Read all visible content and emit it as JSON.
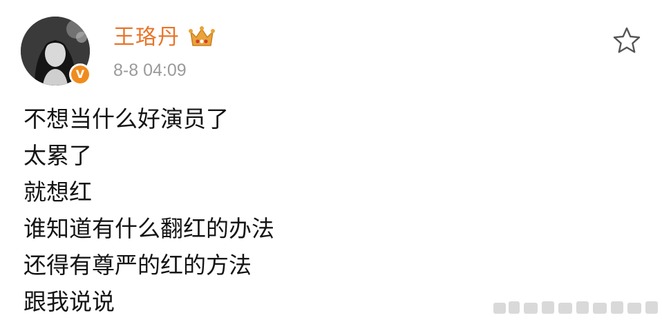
{
  "post": {
    "user": {
      "name": "王珞丹",
      "verified_mark": "V",
      "badge_icon": "crown-icon"
    },
    "timestamp": "8-8 04:09",
    "actions": {
      "favorite_icon": "star-outline-icon"
    },
    "content_lines": [
      "不想当什么好演员了",
      "太累了",
      "就想红",
      "谁知道有什么翻红的办法",
      "还得有尊严的红的方法",
      "跟我说说"
    ]
  },
  "colors": {
    "username": "#e8742a",
    "timestamp": "#9a9a9a",
    "body_text": "#141414",
    "verified_badge": "#f08c1e",
    "crown": "#e8a33a"
  }
}
